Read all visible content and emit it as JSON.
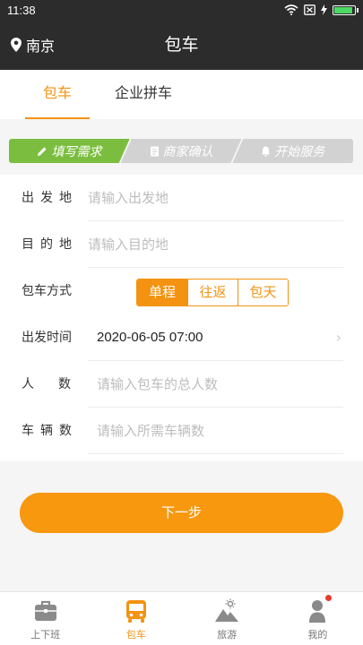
{
  "status_bar": {
    "time": "11:38",
    "battery_level": 0.95
  },
  "header": {
    "location": "南京",
    "title": "包车",
    "location_icon": "location-pin-icon"
  },
  "tabs": [
    {
      "label": "包车",
      "active": true
    },
    {
      "label": "企业拼车",
      "active": false
    }
  ],
  "steps": [
    {
      "label": "填写需求",
      "icon": "pencil-icon",
      "active": true
    },
    {
      "label": "商家确认",
      "icon": "document-icon",
      "active": false
    },
    {
      "label": "开始服务",
      "icon": "bell-icon",
      "active": false
    }
  ],
  "form": {
    "departure": {
      "label": "出发地",
      "placeholder": "请输入出发地"
    },
    "destination": {
      "label": "目的地",
      "placeholder": "请输入目的地"
    },
    "trip_type": {
      "label": "包车方式",
      "options": [
        "单程",
        "往返",
        "包天"
      ],
      "selected": "单程"
    },
    "departure_time": {
      "label": "出发时间",
      "value": "2020-06-05 07:00"
    },
    "people": {
      "label": "人数",
      "placeholder": "请输入包车的总人数"
    },
    "vehicles": {
      "label": "车辆数",
      "placeholder": "请输入所需车辆数"
    }
  },
  "next_button": {
    "label": "下一步"
  },
  "bottom_nav": [
    {
      "label": "上下班",
      "icon": "briefcase-icon",
      "active": false
    },
    {
      "label": "包车",
      "icon": "bus-icon",
      "active": true
    },
    {
      "label": "旅游",
      "icon": "mountain-sun-icon",
      "active": false
    },
    {
      "label": "我的",
      "icon": "user-icon",
      "active": false,
      "badge": true
    }
  ],
  "colors": {
    "accent": "#f39311",
    "step_active": "#7bbe3f",
    "step_inactive": "#d2d2d2",
    "header_bg": "#2c2c2c"
  }
}
